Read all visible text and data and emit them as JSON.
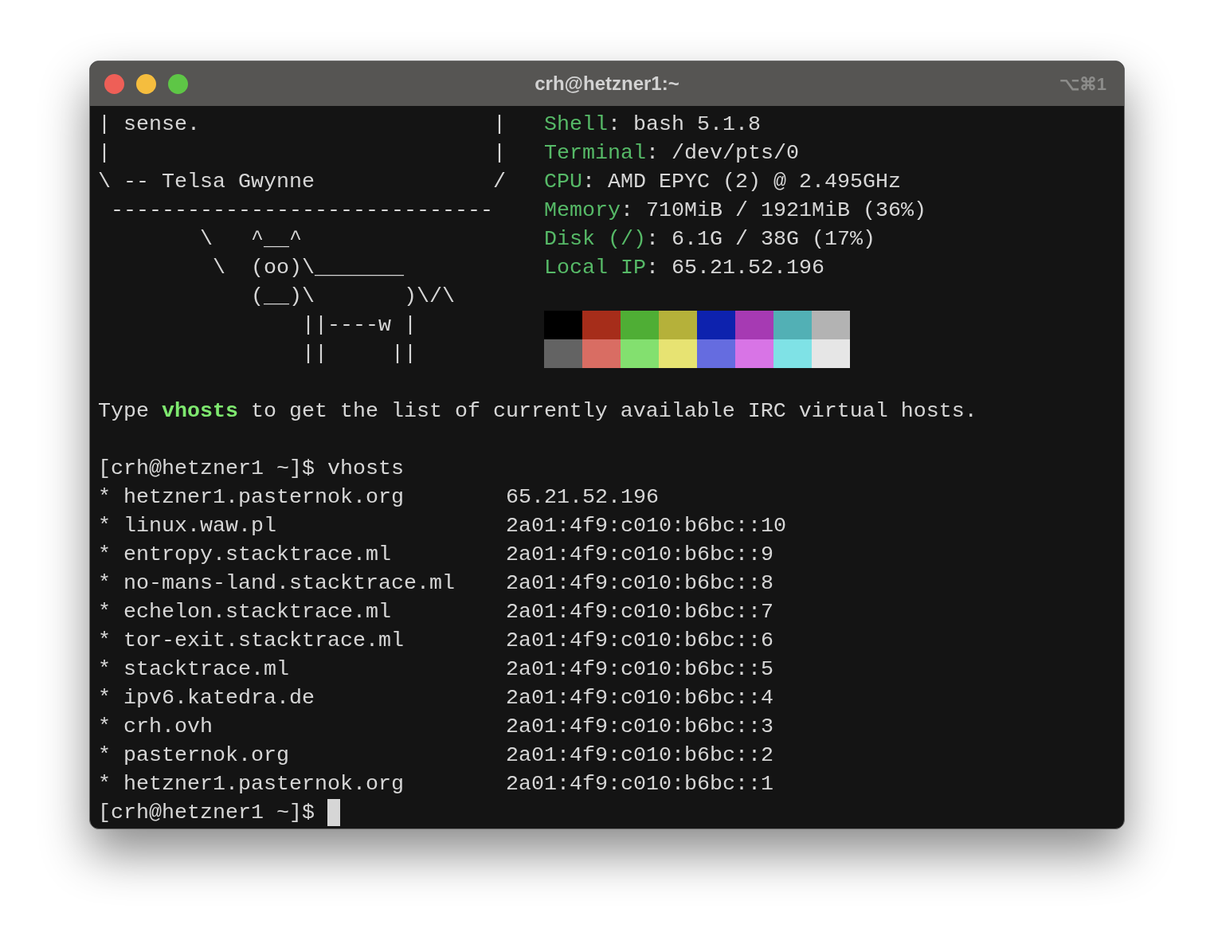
{
  "window": {
    "title": "crh@hetzner1:~",
    "shortcut": "⌥⌘1"
  },
  "cowsay": [
    "| sense.                       |",
    "|                              |",
    "\\ -- Telsa Gwynne              /",
    " ------------------------------",
    "        \\   ^__^",
    "         \\  (oo)\\_______",
    "            (__)\\       )\\/\\",
    "                ||----w |",
    "                ||     ||"
  ],
  "sysinfo": [
    {
      "label": "Shell",
      "value": ": bash 5.1.8"
    },
    {
      "label": "Terminal",
      "value": ": /dev/pts/0"
    },
    {
      "label": "CPU",
      "value": ": AMD EPYC (2) @ 2.495GHz"
    },
    {
      "label": "Memory",
      "value": ": 710MiB / 1921MiB (36%)"
    },
    {
      "label": "Disk (/)",
      "value": ": 6.1G / 38G (17%)"
    },
    {
      "label": "Local IP",
      "value": ": 65.21.52.196"
    }
  ],
  "palette": [
    {
      "swatches": [
        {
          "color": "#000000"
        },
        {
          "color": "#a62d1a"
        },
        {
          "color": "#4fae35"
        },
        {
          "color": "#b5b13a"
        },
        {
          "color": "#0d22ae"
        },
        {
          "color": "#a63ab3"
        },
        {
          "color": "#52b0b5"
        },
        {
          "color": "#b3b3b3"
        }
      ]
    },
    {
      "swatches": [
        {
          "color": "#636363"
        },
        {
          "color": "#d96d63"
        },
        {
          "color": "#83e06f"
        },
        {
          "color": "#e7e372"
        },
        {
          "color": "#656ce0"
        },
        {
          "color": "#d874e6"
        },
        {
          "color": "#7fe2e6"
        },
        {
          "color": "#e6e6e6"
        }
      ]
    }
  ],
  "message": [
    {
      "text": "Type ",
      "highlight": false
    },
    {
      "text": "vhosts",
      "highlight": true
    },
    {
      "text": " to get the list of currently available IRC virtual hosts.",
      "highlight": false
    }
  ],
  "command": {
    "prompt": "[crh@hetzner1 ~]$ ",
    "input": "vhosts"
  },
  "hosts": [
    {
      "name": "* hetzner1.pasternok.org",
      "address": "65.21.52.196"
    },
    {
      "name": "* linux.waw.pl",
      "address": "2a01:4f9:c010:b6bc::10"
    },
    {
      "name": "* entropy.stacktrace.ml",
      "address": "2a01:4f9:c010:b6bc::9"
    },
    {
      "name": "* no-mans-land.stacktrace.ml",
      "address": "2a01:4f9:c010:b6bc::8"
    },
    {
      "name": "* echelon.stacktrace.ml",
      "address": "2a01:4f9:c010:b6bc::7"
    },
    {
      "name": "* tor-exit.stacktrace.ml",
      "address": "2a01:4f9:c010:b6bc::6"
    },
    {
      "name": "* stacktrace.ml",
      "address": "2a01:4f9:c010:b6bc::5"
    },
    {
      "name": "* ipv6.katedra.de",
      "address": "2a01:4f9:c010:b6bc::4"
    },
    {
      "name": "* crh.ovh",
      "address": "2a01:4f9:c010:b6bc::3"
    },
    {
      "name": "* pasternok.org",
      "address": "2a01:4f9:c010:b6bc::2"
    },
    {
      "name": "* hetzner1.pasternok.org",
      "address": "2a01:4f9:c010:b6bc::1"
    }
  ],
  "final_prompt": {
    "prompt": "[crh@hetzner1 ~]$ "
  }
}
